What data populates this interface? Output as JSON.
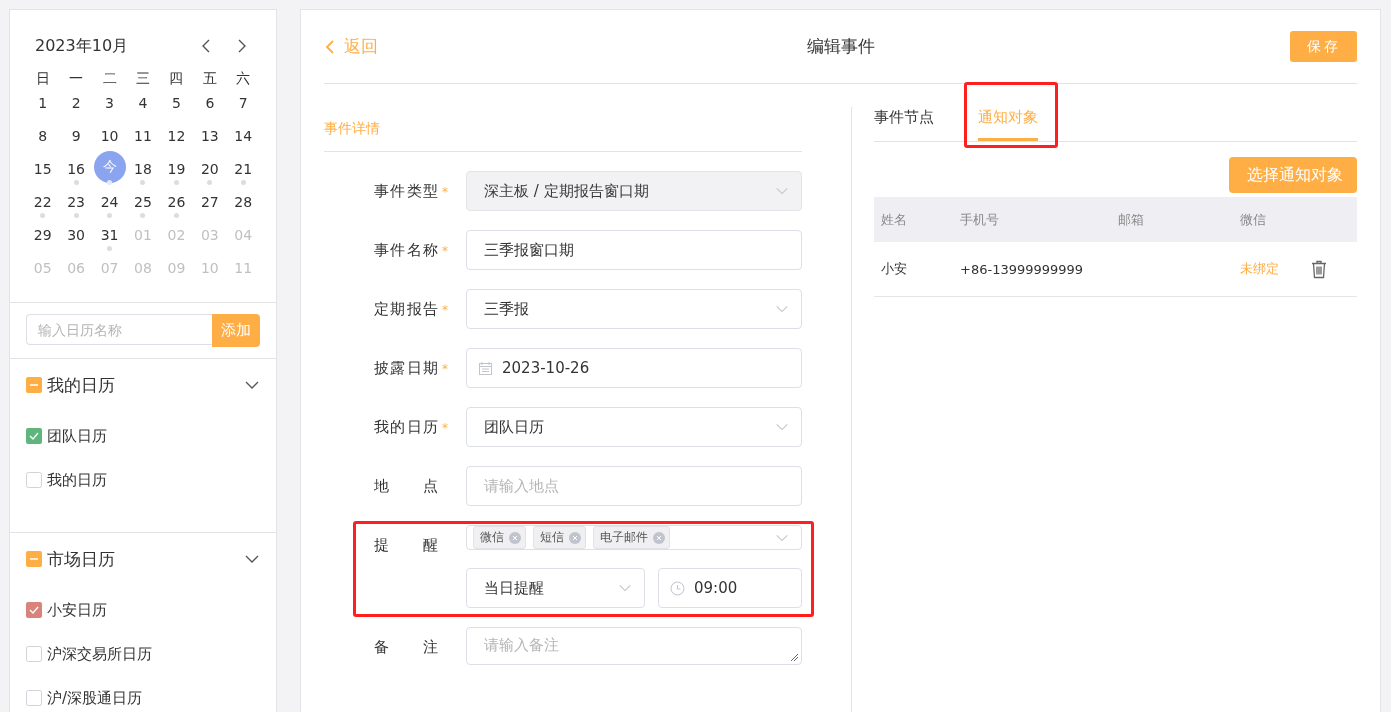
{
  "calendar": {
    "title": "2023年10月",
    "weekdays": [
      "日",
      "一",
      "二",
      "三",
      "四",
      "五",
      "六"
    ],
    "days": [
      {
        "label": "1",
        "other_month": false,
        "today": false,
        "has_event": false
      },
      {
        "label": "2",
        "other_month": false,
        "today": false,
        "has_event": false
      },
      {
        "label": "3",
        "other_month": false,
        "today": false,
        "has_event": false
      },
      {
        "label": "4",
        "other_month": false,
        "today": false,
        "has_event": false
      },
      {
        "label": "5",
        "other_month": false,
        "today": false,
        "has_event": false
      },
      {
        "label": "6",
        "other_month": false,
        "today": false,
        "has_event": false
      },
      {
        "label": "7",
        "other_month": false,
        "today": false,
        "has_event": false
      },
      {
        "label": "8",
        "other_month": false,
        "today": false,
        "has_event": false
      },
      {
        "label": "9",
        "other_month": false,
        "today": false,
        "has_event": false
      },
      {
        "label": "10",
        "other_month": false,
        "today": false,
        "has_event": false
      },
      {
        "label": "11",
        "other_month": false,
        "today": false,
        "has_event": false
      },
      {
        "label": "12",
        "other_month": false,
        "today": false,
        "has_event": false
      },
      {
        "label": "13",
        "other_month": false,
        "today": false,
        "has_event": false
      },
      {
        "label": "14",
        "other_month": false,
        "today": false,
        "has_event": false
      },
      {
        "label": "15",
        "other_month": false,
        "today": false,
        "has_event": false
      },
      {
        "label": "16",
        "other_month": false,
        "today": false,
        "has_event": true
      },
      {
        "label": "今",
        "other_month": false,
        "today": true,
        "has_event": true
      },
      {
        "label": "18",
        "other_month": false,
        "today": false,
        "has_event": true
      },
      {
        "label": "19",
        "other_month": false,
        "today": false,
        "has_event": true
      },
      {
        "label": "20",
        "other_month": false,
        "today": false,
        "has_event": true
      },
      {
        "label": "21",
        "other_month": false,
        "today": false,
        "has_event": true
      },
      {
        "label": "22",
        "other_month": false,
        "today": false,
        "has_event": true
      },
      {
        "label": "23",
        "other_month": false,
        "today": false,
        "has_event": true
      },
      {
        "label": "24",
        "other_month": false,
        "today": false,
        "has_event": true
      },
      {
        "label": "25",
        "other_month": false,
        "today": false,
        "has_event": true
      },
      {
        "label": "26",
        "other_month": false,
        "today": false,
        "has_event": true
      },
      {
        "label": "27",
        "other_month": false,
        "today": false,
        "has_event": false
      },
      {
        "label": "28",
        "other_month": false,
        "today": false,
        "has_event": false
      },
      {
        "label": "29",
        "other_month": false,
        "today": false,
        "has_event": false
      },
      {
        "label": "30",
        "other_month": false,
        "today": false,
        "has_event": false
      },
      {
        "label": "31",
        "other_month": false,
        "today": false,
        "has_event": true
      },
      {
        "label": "01",
        "other_month": true,
        "today": false,
        "has_event": false
      },
      {
        "label": "02",
        "other_month": true,
        "today": false,
        "has_event": false
      },
      {
        "label": "03",
        "other_month": true,
        "today": false,
        "has_event": false
      },
      {
        "label": "04",
        "other_month": true,
        "today": false,
        "has_event": false
      },
      {
        "label": "05",
        "other_month": true,
        "today": false,
        "has_event": false
      },
      {
        "label": "06",
        "other_month": true,
        "today": false,
        "has_event": false
      },
      {
        "label": "07",
        "other_month": true,
        "today": false,
        "has_event": false
      },
      {
        "label": "08",
        "other_month": true,
        "today": false,
        "has_event": false
      },
      {
        "label": "09",
        "other_month": true,
        "today": false,
        "has_event": false
      },
      {
        "label": "10",
        "other_month": true,
        "today": false,
        "has_event": false
      },
      {
        "label": "11",
        "other_month": true,
        "today": false,
        "has_event": false
      }
    ]
  },
  "new_calendar": {
    "placeholder": "输入日历名称",
    "button": "添加"
  },
  "calendar_groups": [
    {
      "title": "我的日历",
      "indeterminate": true,
      "expanded": true,
      "items": [
        {
          "label": "团队日历",
          "checked": true,
          "color": "#5fb67c"
        },
        {
          "label": "我的日历",
          "checked": false
        }
      ]
    },
    {
      "title": "市场日历",
      "indeterminate": true,
      "expanded": true,
      "items": [
        {
          "label": "小安日历",
          "checked": true,
          "color": "#d9847a"
        },
        {
          "label": "沪深交易所日历",
          "checked": false
        },
        {
          "label": "沪/深股通日历",
          "checked": false
        }
      ]
    }
  ],
  "header": {
    "back": "返回",
    "title": "编辑事件",
    "save": "保存"
  },
  "section_title": "事件详情",
  "required_mark": "*",
  "fields": [
    {
      "kind": "select",
      "label": "事件类型",
      "required": true,
      "value": "深主板 / 定期报告窗口期",
      "disabled": true
    },
    {
      "kind": "input",
      "label": "事件名称",
      "required": true,
      "value": "三季报窗口期"
    },
    {
      "kind": "select",
      "label": "定期报告",
      "required": true,
      "value": "三季报",
      "disabled": false
    },
    {
      "kind": "date",
      "label": "披露日期",
      "required": true,
      "value": "2023-10-26"
    },
    {
      "kind": "select",
      "label": "我的日历",
      "required": true,
      "value": "团队日历",
      "disabled": false
    },
    {
      "kind": "input",
      "label": "地 点",
      "required": false,
      "placeholder": "请输入地点"
    },
    {
      "kind": "reminder",
      "label": "提 醒",
      "required": false,
      "highlighted": true,
      "tags": [
        "微信",
        "短信",
        "电子邮件"
      ],
      "timing": "当日提醒",
      "time": "09:00"
    },
    {
      "kind": "textarea",
      "label": "备 注",
      "required": false,
      "placeholder": "请输入备注"
    }
  ],
  "tabs": [
    {
      "label": "事件节点",
      "selected": false,
      "highlighted": false
    },
    {
      "label": "通知对象",
      "selected": true,
      "highlighted": true
    }
  ],
  "select_button": "选择通知对象",
  "table": {
    "columns": [
      "姓名",
      "手机号",
      "邮箱",
      "微信"
    ],
    "rows": [
      {
        "name": "小安",
        "phone": "+86-13999999999",
        "wechat": "未绑定"
      }
    ]
  }
}
